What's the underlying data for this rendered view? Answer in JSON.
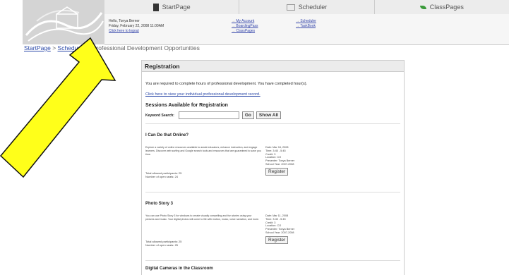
{
  "topnav": {
    "tabs": [
      {
        "label": "StartPage",
        "icon": "book-icon"
      },
      {
        "label": "Scheduler",
        "icon": "calendar-icon"
      },
      {
        "label": "ClassPages",
        "icon": "leaf-icon"
      }
    ]
  },
  "userbar": {
    "greeting": "Hello, Tonya Berner",
    "date": "Friday, February 22, 2008 11:00AM",
    "logout": "Click here to logout",
    "links_col1": [
      "My Account",
      "BoardingPass",
      "ClassPages"
    ],
    "links_col2": [
      "Scheduler",
      "TaskBook"
    ]
  },
  "breadcrumb": {
    "home": "StartPage",
    "sep": ">",
    "scheduler": "Schedu",
    "current": "Professional Development Opportunities"
  },
  "registration": {
    "title": "Registration",
    "required_text": "You are required to complete hours of professional development. You have completed hour(s).",
    "record_link": "Click here to view your individual professional development record.",
    "sessions_heading": "Sessions Available for Registration",
    "search_label": "Keyword Search:",
    "search_value": "",
    "go_label": "Go",
    "show_all_label": "Show All",
    "register_label": "Register",
    "sessions": [
      {
        "title": "I Can Do that Online?",
        "desc": "Explore a variety of online resources available to assist educators, enhance instruction, and engage learners. Discover web surfing and Google search tools and resources that are guaranteed to save you time.",
        "date": "Date: Mar 04, 2008",
        "time": "Time: 3:45 - 5:45",
        "credit": "Credit: 3",
        "location": "Location: CO",
        "presenter": "Presenter: Tonya Berner",
        "year": "School Year: 2007-2008",
        "allowed": "Total allowed participants: 25",
        "open": "Number of open seats: 24"
      },
      {
        "title": "Photo Story 3",
        "desc": "You can use Photo Story 3 for windows to create visually compelling and fun stories using your pictures and music. Your digital photos will come to life with motion, music, voice narration, and more.",
        "date": "Date: Mar 11, 2008",
        "time": "Time: 3:45 - 5:45",
        "credit": "Credit: 3",
        "location": "Location: CO",
        "presenter": "Presenter: Tonya Berner",
        "year": "School Year: 2007-2008",
        "allowed": "Total allowed participants: 25",
        "open": "Number of open seats: 25"
      }
    ],
    "next_title": "Digital Cameras in the Classroom"
  },
  "colors": {
    "arrow_fill": "#ffff1a",
    "link": "#2a48a8"
  }
}
